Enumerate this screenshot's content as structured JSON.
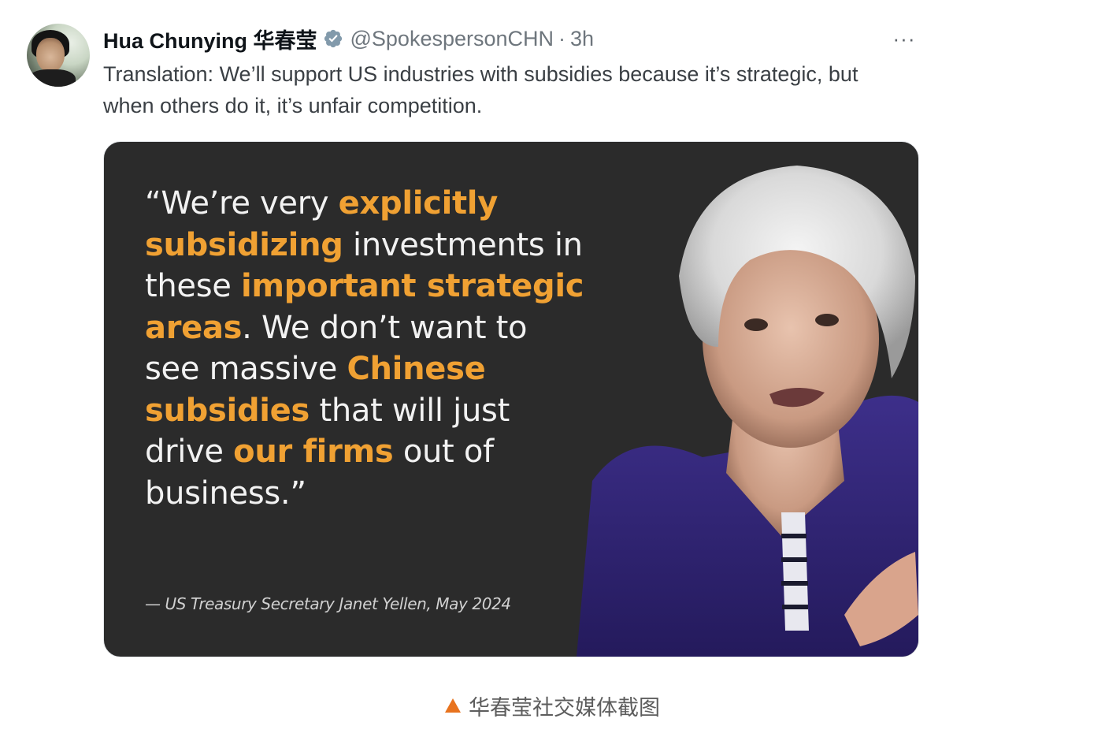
{
  "tweet": {
    "author_name": "Hua Chunying 华春莹",
    "handle": "@SpokespersonCHN",
    "separator": "·",
    "time": "3h",
    "more_label": "···",
    "text": "Translation: We’ll support US industries with subsidies because it’s strategic, but when others do it, it’s unfair competition."
  },
  "media": {
    "quote": [
      {
        "text": "“We’re very ",
        "hl": false
      },
      {
        "text": "explicitly subsidizing",
        "hl": true
      },
      {
        "text": " investments in these ",
        "hl": false
      },
      {
        "text": "important strategic areas",
        "hl": true
      },
      {
        "text": ". We don’t want to see massive ",
        "hl": false
      },
      {
        "text": "Chinese subsidies",
        "hl": true
      },
      {
        "text": " that will just drive ",
        "hl": false
      },
      {
        "text": "our firms",
        "hl": true
      },
      {
        "text": " out of business.”",
        "hl": false
      }
    ],
    "attribution": "— US Treasury Secretary Janet Yellen, May 2024",
    "highlight_color": "#f0a133",
    "background_color": "#2b2b2b"
  },
  "caption": {
    "text": "华春莹社交媒体截图",
    "marker_color": "#e8731e"
  },
  "icons": {
    "verified": "verified-badge-icon",
    "more": "more-horizontal-icon",
    "caption_marker": "triangle-icon"
  }
}
